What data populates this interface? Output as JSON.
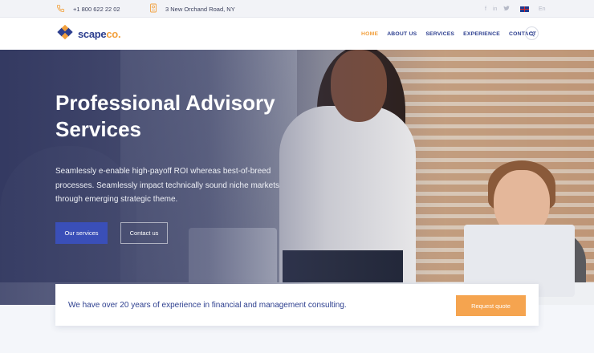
{
  "topbar": {
    "phone": "+1 800 622 22 02",
    "address": "3 New Orchand Road, NY",
    "social": [
      "f",
      "in",
      "t"
    ],
    "language": "En"
  },
  "header": {
    "logo_main": "scape",
    "logo_accent": "co.",
    "nav": [
      {
        "label": "HOME",
        "active": true
      },
      {
        "label": "ABOUT US",
        "active": false
      },
      {
        "label": "SERVICES",
        "active": false
      },
      {
        "label": "EXPERIENCE",
        "active": false
      },
      {
        "label": "CONTACT",
        "active": false
      }
    ]
  },
  "hero": {
    "title": "Professional Advisory Services",
    "text": "Seamlessly e-enable high-payoff ROI whereas best-of-breed processes. Seamlessly impact technically sound niche markets through emerging strategic theme.",
    "primary_button": "Our services",
    "secondary_button": "Contact us"
  },
  "cta": {
    "text": "We have over 20 years of experience in financial and management consulting.",
    "button": "Request quote"
  },
  "colors": {
    "brand_blue": "#2d3f8f",
    "accent_orange": "#f2a03d",
    "button_blue": "#3a4fb8",
    "quote_orange": "#f5a44f"
  }
}
